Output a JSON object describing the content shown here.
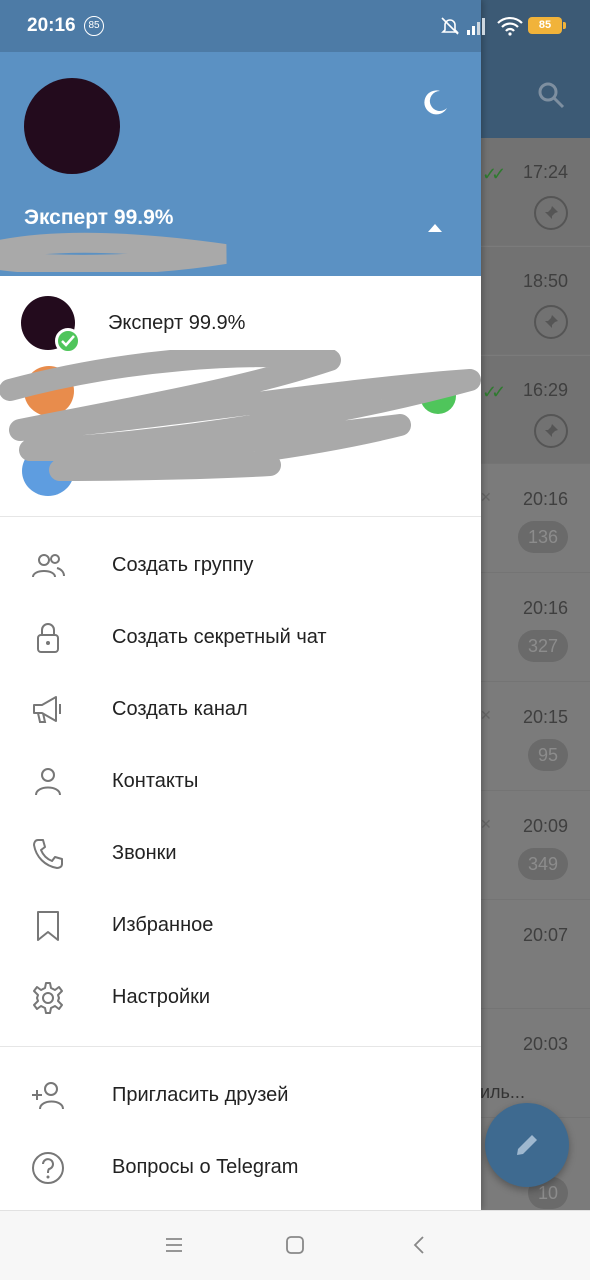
{
  "status_bar": {
    "time": "20:16",
    "notification_count": "85",
    "battery": "85"
  },
  "drawer": {
    "header": {
      "name": "Эксперт 99.9%"
    },
    "current_account": {
      "name": "Эксперт 99.9%"
    },
    "menu_primary": [
      {
        "label": "Создать группу",
        "icon": "group-icon"
      },
      {
        "label": "Создать секретный чат",
        "icon": "lock-icon"
      },
      {
        "label": "Создать канал",
        "icon": "megaphone-icon"
      },
      {
        "label": "Контакты",
        "icon": "contact-icon"
      },
      {
        "label": "Звонки",
        "icon": "phone-icon"
      },
      {
        "label": "Избранное",
        "icon": "bookmark-icon"
      },
      {
        "label": "Настройки",
        "icon": "gear-icon"
      }
    ],
    "menu_secondary": [
      {
        "label": "Пригласить друзей",
        "icon": "add-person-icon"
      },
      {
        "label": "Вопросы о Telegram",
        "icon": "help-icon"
      }
    ]
  },
  "chat_list": {
    "rows": [
      {
        "time": "17:24",
        "pinned": true,
        "read": true
      },
      {
        "time": "18:50",
        "pinned": true
      },
      {
        "time": "16:29",
        "pinned": true,
        "read": true
      },
      {
        "time": "20:16",
        "badge": "136",
        "muted": true
      },
      {
        "time": "20:16",
        "badge": "327"
      },
      {
        "time": "20:15",
        "badge": "95",
        "muted": true
      },
      {
        "time": "20:09",
        "badge": "349",
        "muted": true
      },
      {
        "time": "20:07"
      },
      {
        "time": "20:03",
        "snippet": "иль..."
      },
      {
        "badge": "10"
      }
    ]
  },
  "colors": {
    "drawer_header": "#5b91c3",
    "accent_green": "#4fc55b"
  }
}
